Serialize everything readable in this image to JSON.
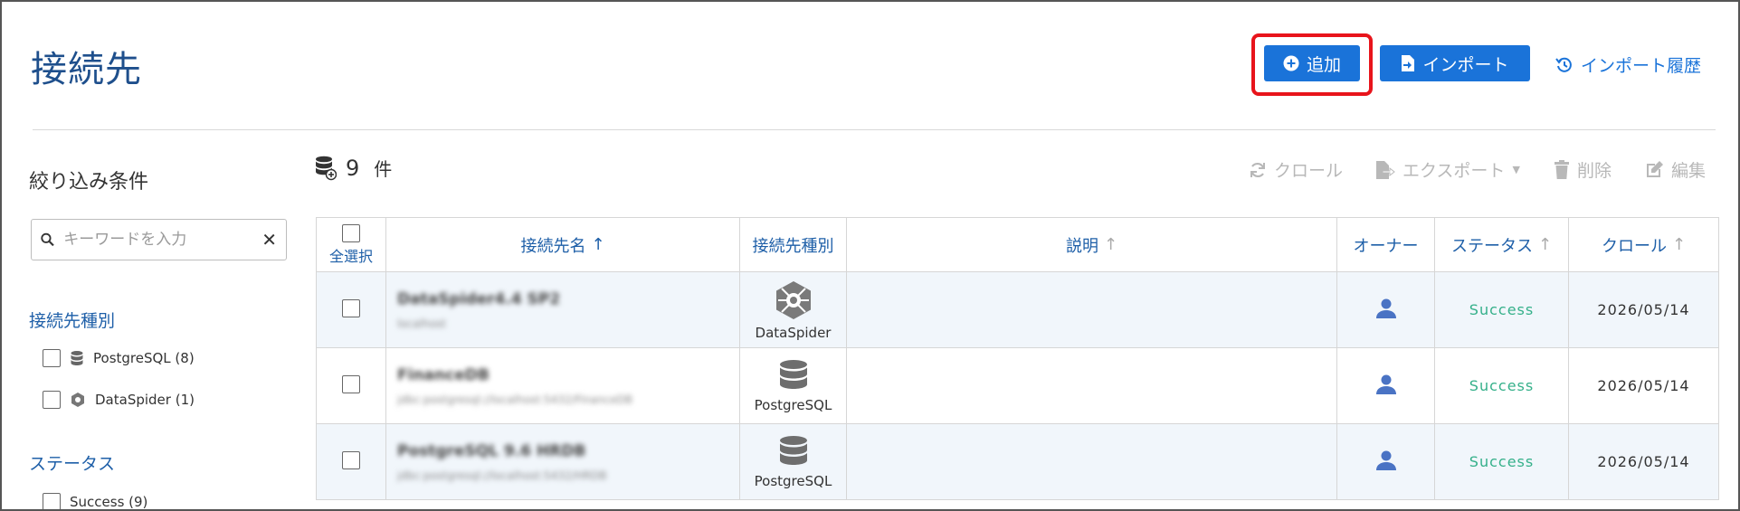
{
  "header": {
    "title": "接続先",
    "add_label": "追加",
    "import_label": "インポート",
    "history_label": "インポート履歴"
  },
  "sidebar": {
    "title": "絞り込み条件",
    "search_placeholder": "キーワードを入力",
    "sections": [
      {
        "title": "接続先種別",
        "items": [
          {
            "label": "PostgreSQL (8)",
            "icon": "database-icon"
          },
          {
            "label": "DataSpider (1)",
            "icon": "dataspider-icon"
          }
        ]
      },
      {
        "title": "ステータス",
        "items": [
          {
            "label": "Success (9)"
          }
        ]
      }
    ]
  },
  "main": {
    "count": "9",
    "count_unit": "件",
    "toolbar": {
      "crawl": "クロール",
      "export": "エクスポート",
      "delete": "削除",
      "edit": "編集"
    },
    "table": {
      "headers": {
        "select_all": "全選択",
        "name": "接続先名",
        "type": "接続先種別",
        "description": "説明",
        "owner": "オーナー",
        "status": "ステータス",
        "crawl": "クロール"
      },
      "rows": [
        {
          "name": "DataSpider4.4 SP2",
          "url": "localhost",
          "type": "DataSpider",
          "status": "Success",
          "date": "2026/05/14"
        },
        {
          "name": "FinanceDB",
          "url": "jdbc:postgresql://localhost:5432/FinanceDB",
          "type": "PostgreSQL",
          "status": "Success",
          "date": "2026/05/14"
        },
        {
          "name": "PostgreSQL 9.6 HRDB",
          "url": "jdbc:postgresql://localhost:5432/HRDB",
          "type": "PostgreSQL",
          "status": "Success",
          "date": "2026/05/14"
        }
      ]
    }
  },
  "colors": {
    "accent": "#1a73d9",
    "title": "#1e4f8c",
    "highlight": "#e8141b",
    "success": "#35b08a",
    "disabled": "#b8b8b8"
  }
}
